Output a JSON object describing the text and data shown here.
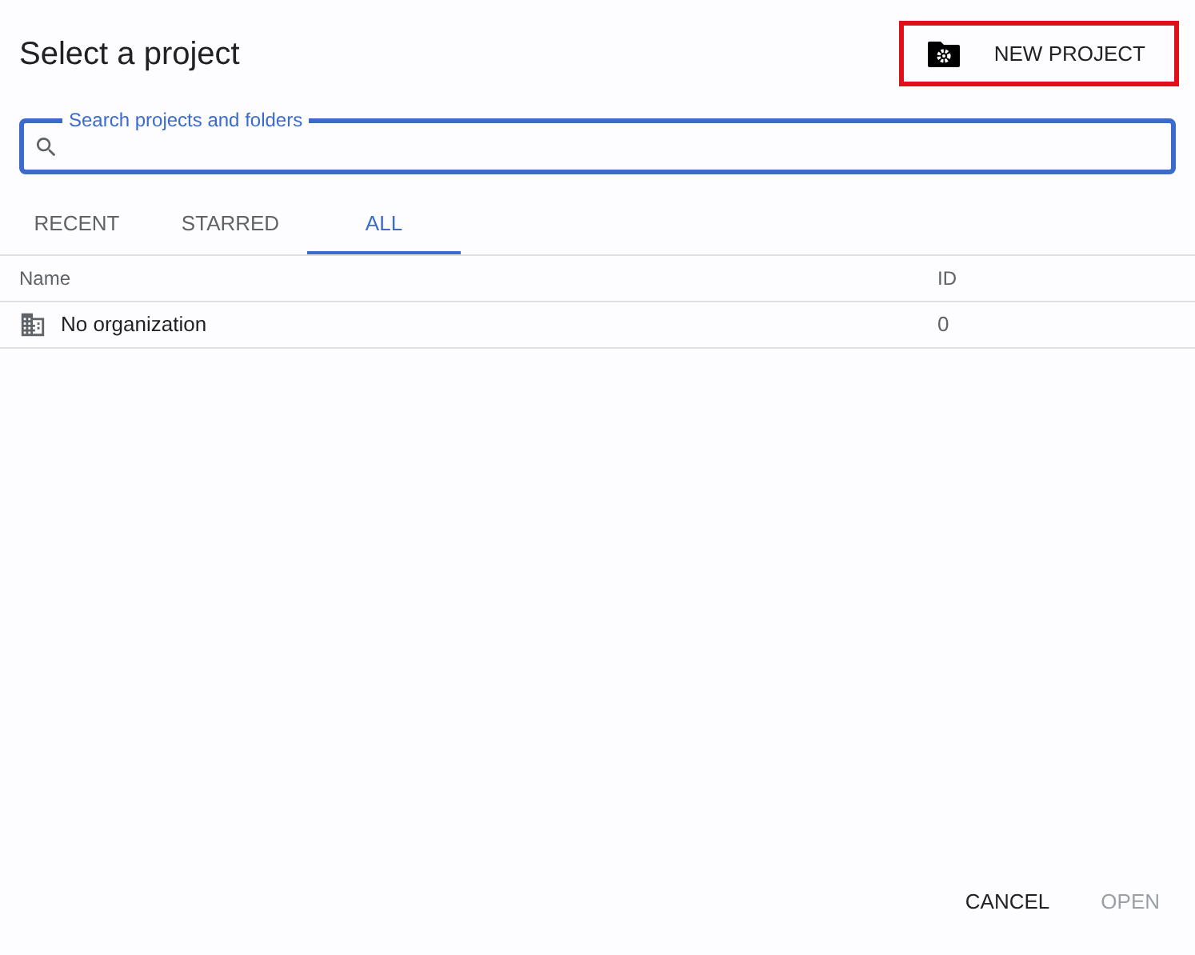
{
  "dialog": {
    "title": "Select a project"
  },
  "new_project": {
    "label": "NEW PROJECT",
    "highlighted": true
  },
  "search": {
    "placeholder": "Search projects and folders"
  },
  "tabs": [
    {
      "label": "RECENT",
      "selected": false
    },
    {
      "label": "STARRED",
      "selected": false
    },
    {
      "label": "ALL",
      "selected": true
    }
  ],
  "table": {
    "columns": [
      "Name",
      "ID"
    ],
    "rows": [
      {
        "name": "No organization",
        "id": "0"
      }
    ]
  },
  "buttons": [
    {
      "label": "CANCEL",
      "disabled": false
    },
    {
      "label": "OPEN",
      "disabled": true
    }
  ]
}
